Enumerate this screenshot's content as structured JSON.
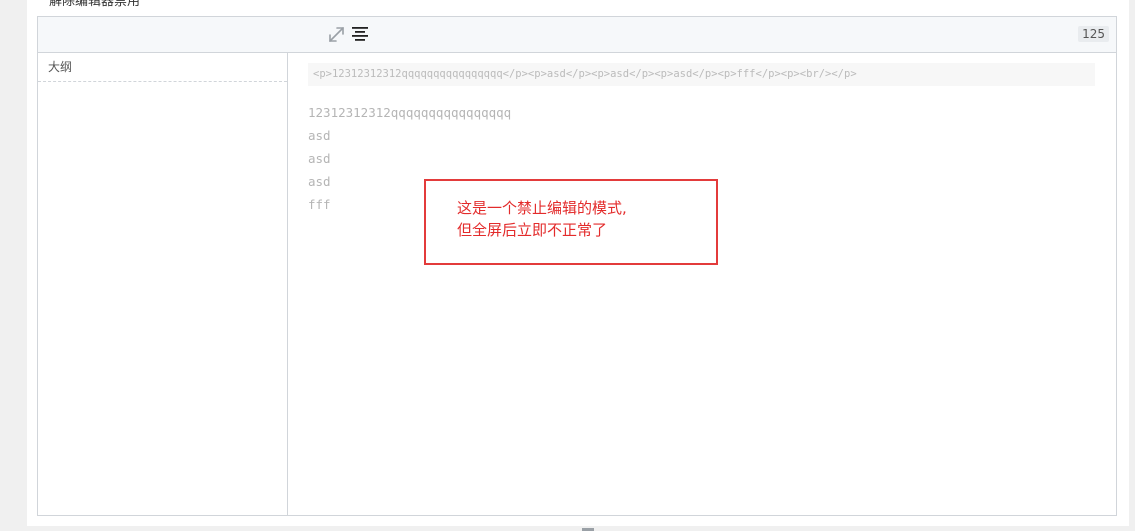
{
  "page": {
    "title": "解除编辑器禁用"
  },
  "toolbar": {
    "fullscreen_icon": "expand-arrows-icon",
    "align_icon": "align-center-icon",
    "counter": "125"
  },
  "outline": {
    "title": "大纲"
  },
  "content": {
    "source": "<p>12312312312qqqqqqqqqqqqqqqq</p><p>asd</p><p>asd</p><p>asd</p><p>fff</p><p><br/></p>",
    "paragraphs": [
      "12312312312qqqqqqqqqqqqqqqq",
      "asd",
      "asd",
      "asd",
      "fff"
    ]
  },
  "annotation": {
    "line1": "这是一个禁止编辑的模式,",
    "line2": "但全屏后立即不正常了",
    "color": "#e33b3b"
  }
}
